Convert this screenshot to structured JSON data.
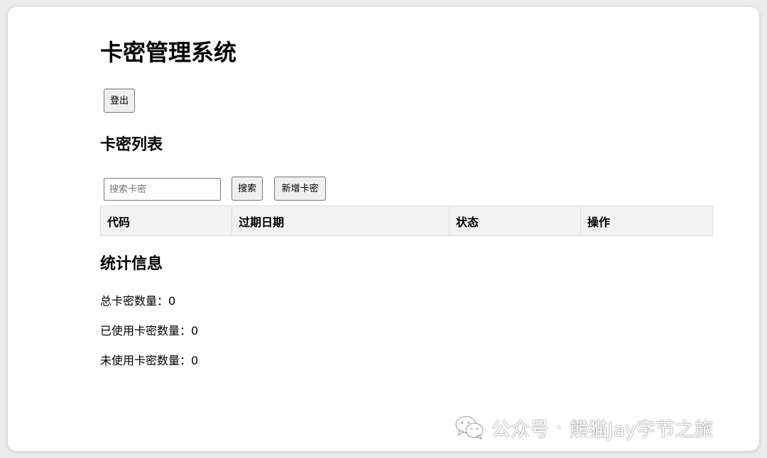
{
  "page": {
    "title": "卡密管理系统",
    "logout_label": "登出"
  },
  "card_list": {
    "title": "卡密列表",
    "search_placeholder": "搜索卡密",
    "search_label": "搜索",
    "add_label": "新增卡密",
    "columns": [
      "代码",
      "过期日期",
      "状态",
      "操作"
    ],
    "rows": []
  },
  "stats": {
    "title": "统计信息",
    "total_label": "总卡密数量：",
    "total_value": "0",
    "used_label": "已使用卡密数量：",
    "used_value": "0",
    "unused_label": "未使用卡密数量：",
    "unused_value": "0"
  },
  "watermark": {
    "icon": "wechat-icon",
    "prefix": "公众号",
    "separator": "·",
    "account": "熊猫Jay字节之旅"
  }
}
